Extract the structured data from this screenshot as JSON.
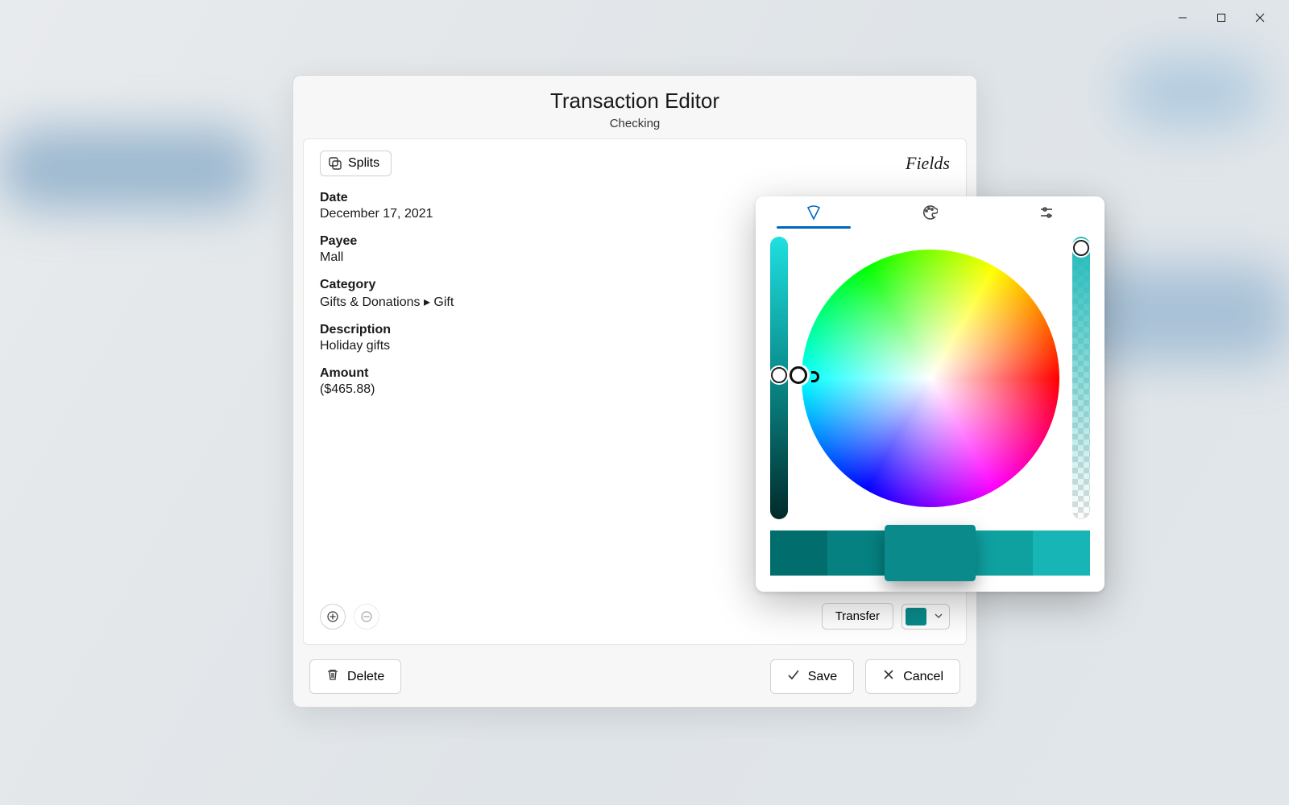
{
  "dialog": {
    "title": "Transaction Editor",
    "subtitle": "Checking",
    "splits_label": "Splits",
    "fields_heading": "Fields"
  },
  "fields": {
    "date": {
      "label": "Date",
      "value": "December 17, 2021"
    },
    "payee": {
      "label": "Payee",
      "value": "Mall"
    },
    "category": {
      "label": "Category",
      "value": "Gifts & Donations ▸ Gift"
    },
    "description": {
      "label": "Description",
      "value": "Holiday gifts"
    },
    "amount": {
      "label": "Amount",
      "value": "($465.88)"
    }
  },
  "footer": {
    "delete_label": "Delete",
    "save_label": "Save",
    "cancel_label": "Cancel",
    "transfer_label": "Transfer"
  },
  "color": {
    "current": "#0a8a8a",
    "shades": [
      "#026d6d",
      "#058181",
      "#0a8a8a",
      "#0fa0a0",
      "#17b5b5"
    ],
    "selected_shade_index": 2
  }
}
